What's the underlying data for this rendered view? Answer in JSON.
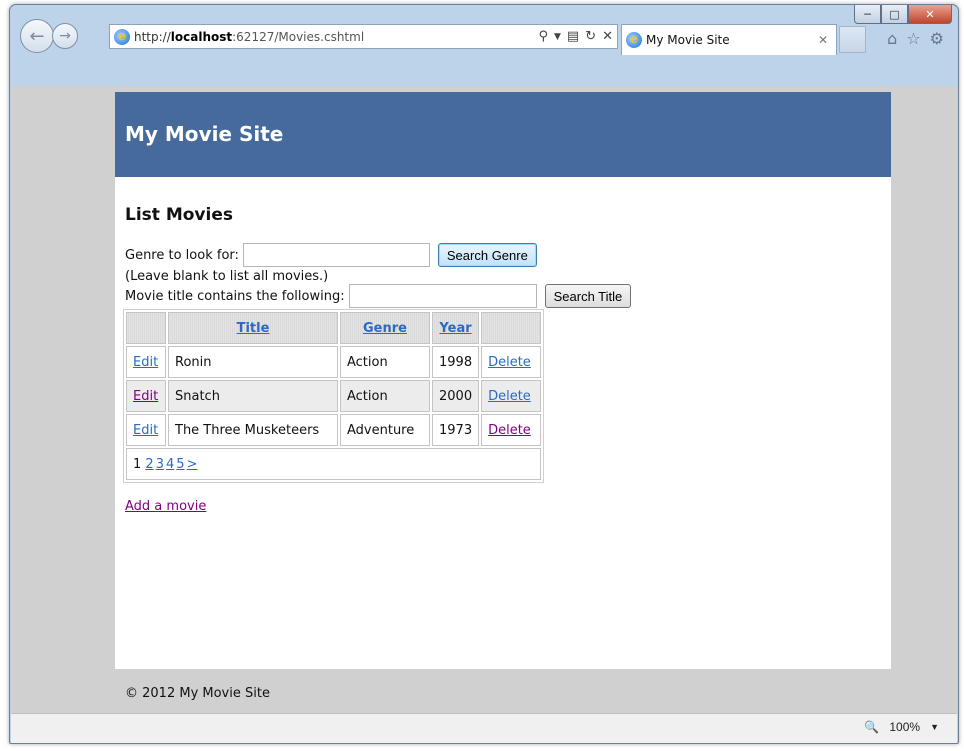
{
  "browser": {
    "url_scheme": "http://",
    "url_host": "localhost",
    "url_path": ":62127/Movies.cshtml",
    "tab_title": "My Movie Site",
    "zoom": "100%"
  },
  "site": {
    "header_title": "My Movie Site",
    "page_title": "List Movies",
    "genre_label": "Genre to look for:",
    "genre_button": "Search Genre",
    "genre_hint": "(Leave blank to list all movies.)",
    "title_label": "Movie title contains the following:",
    "title_button": "Search Title",
    "columns": [
      "Title",
      "Genre",
      "Year"
    ],
    "rows": [
      {
        "edit": "Edit",
        "title": "Ronin",
        "genre": "Action",
        "year": "1998",
        "delete": "Delete"
      },
      {
        "edit": "Edit",
        "title": "Snatch",
        "genre": "Action",
        "year": "2000",
        "delete": "Delete"
      },
      {
        "edit": "Edit",
        "title": "The Three Musketeers",
        "genre": "Adventure",
        "year": "1973",
        "delete": "Delete"
      }
    ],
    "pager": {
      "current": "1",
      "pages": [
        "2",
        "3",
        "4",
        "5"
      ],
      "next": ">"
    },
    "add_link": "Add a movie",
    "footer": "© 2012 My Movie Site"
  }
}
